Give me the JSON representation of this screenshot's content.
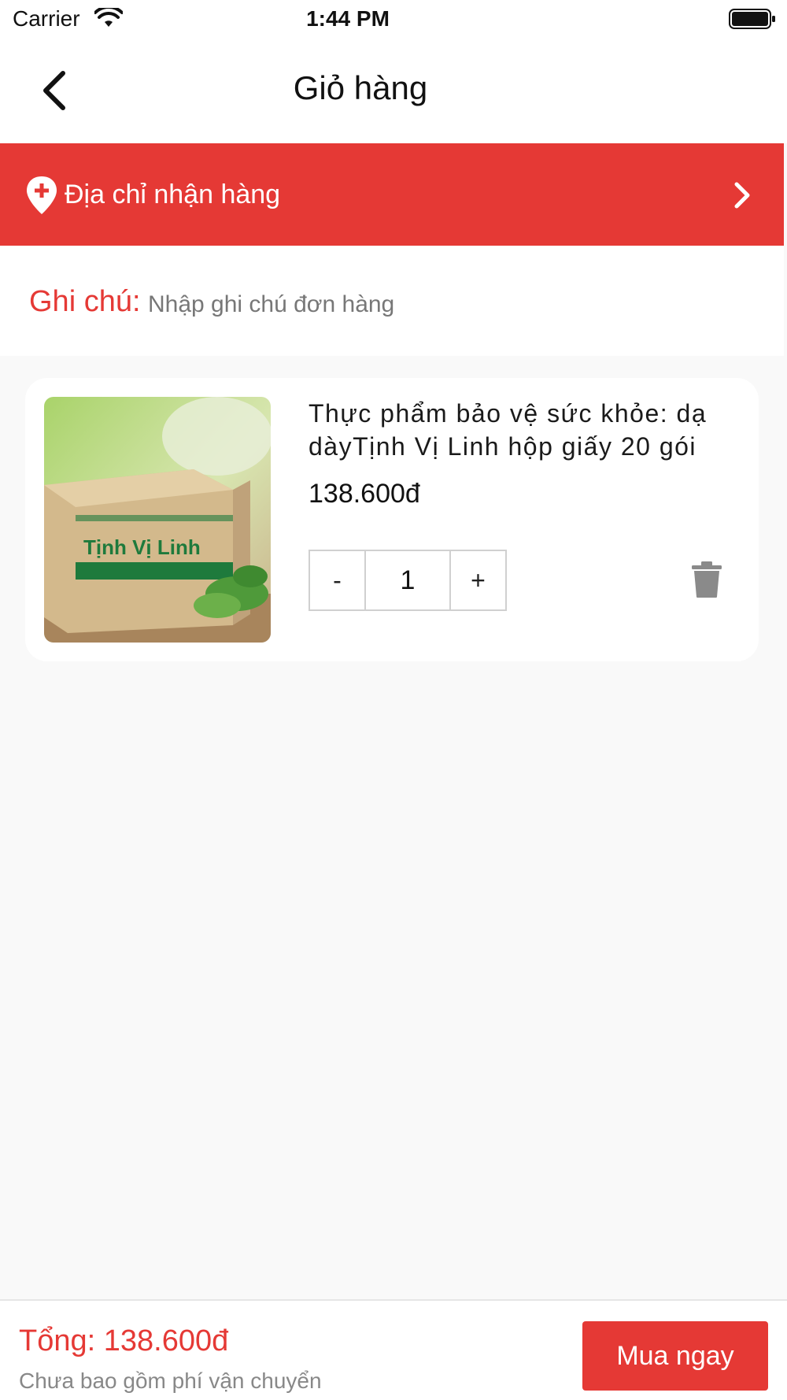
{
  "status_bar": {
    "carrier": "Carrier",
    "time": "1:44 PM"
  },
  "nav": {
    "title": "Giỏ hàng",
    "back_icon": "chevron-left-icon"
  },
  "address": {
    "label": "Địa chỉ nhận hàng",
    "pin_icon": "location-pin-icon",
    "chevron_icon": "chevron-right-icon"
  },
  "note": {
    "label": "Ghi chú:",
    "placeholder": "Nhập ghi chú đơn hàng"
  },
  "cart": {
    "items": [
      {
        "name": "Thực phẩm bảo vệ sức khỏe: dạ dàyTịnh Vị Linh hộp giấy 20 gói",
        "price": "138.600đ",
        "quantity": "1",
        "decrement_label": "-",
        "increment_label": "+",
        "image_brand_text": "Tịnh Vị Linh"
      }
    ]
  },
  "footer": {
    "total": "Tổng: 138.600đ",
    "shipping_note": "Chưa bao gồm phí vận chuyển",
    "buy_label": "Mua ngay"
  },
  "colors": {
    "accent": "#e53935",
    "background": "#f9f9f9"
  }
}
